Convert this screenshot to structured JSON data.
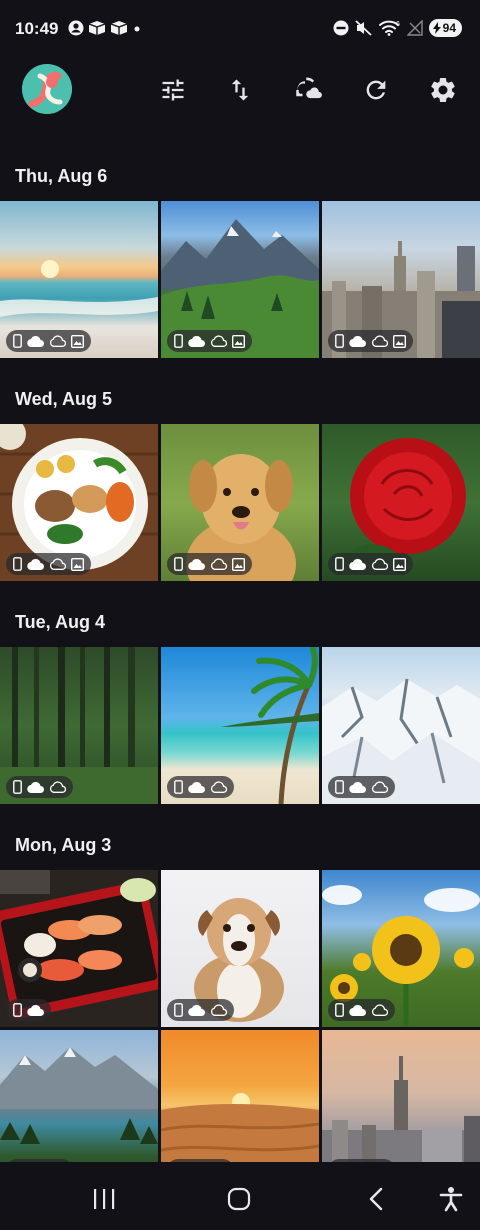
{
  "status_bar": {
    "time": "10:49",
    "battery": "94",
    "wifi_label": "6"
  },
  "toolbar": {
    "icons": [
      "app-logo",
      "tune-icon",
      "sort-icon",
      "cloud-sync-icon",
      "refresh-icon",
      "settings-icon"
    ]
  },
  "sections": [
    {
      "date": "Thu, Aug 6",
      "items": [
        {
          "name": "beach-sunset",
          "badges": [
            "phone",
            "cloud",
            "cloud-outline",
            "image"
          ]
        },
        {
          "name": "mountain-valley",
          "badges": [
            "phone",
            "cloud",
            "cloud-outline",
            "image"
          ]
        },
        {
          "name": "city-skyline",
          "badges": [
            "phone",
            "cloud",
            "cloud-outline",
            "image"
          ]
        }
      ]
    },
    {
      "date": "Wed, Aug 5",
      "items": [
        {
          "name": "food-plate",
          "badges": [
            "phone",
            "cloud",
            "cloud-outline",
            "image"
          ]
        },
        {
          "name": "golden-retriever",
          "badges": [
            "phone",
            "cloud",
            "cloud-outline",
            "image"
          ]
        },
        {
          "name": "red-rose",
          "badges": [
            "phone",
            "cloud",
            "cloud-outline",
            "image"
          ]
        }
      ]
    },
    {
      "date": "Tue, Aug 4",
      "items": [
        {
          "name": "forest",
          "badges": [
            "phone",
            "cloud",
            "cloud-outline"
          ]
        },
        {
          "name": "tropical-beach",
          "badges": [
            "phone",
            "cloud",
            "cloud-outline"
          ]
        },
        {
          "name": "snowy-mountains",
          "badges": [
            "phone",
            "cloud",
            "cloud-outline"
          ]
        }
      ]
    },
    {
      "date": "Mon, Aug 3",
      "items": [
        {
          "name": "sushi-platter",
          "badges": [
            "phone",
            "cloud"
          ]
        },
        {
          "name": "bulldog-puppy",
          "badges": [
            "phone",
            "cloud",
            "cloud-outline"
          ]
        },
        {
          "name": "sunflowers",
          "badges": [
            "phone",
            "cloud",
            "cloud-outline"
          ]
        },
        {
          "name": "lake-mountains",
          "badges": [
            "phone",
            "cloud",
            "cloud-outline"
          ]
        },
        {
          "name": "desert-sunset",
          "badges": [
            "phone",
            "cloud",
            "cloud-outline"
          ]
        },
        {
          "name": "skyscraper-dusk",
          "badges": [
            "phone",
            "cloud",
            "cloud-outline"
          ]
        }
      ]
    }
  ],
  "nav_bar": {
    "icons": [
      "recent-apps-icon",
      "home-icon",
      "back-icon",
      "accessibility-icon"
    ]
  }
}
